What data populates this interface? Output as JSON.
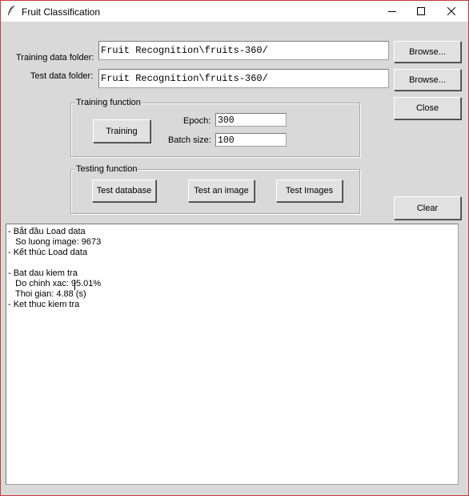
{
  "window": {
    "title": "Fruit Classification",
    "minimize_icon": "minimize-icon",
    "maximize_icon": "maximize-icon",
    "close_icon": "close-icon"
  },
  "form": {
    "training_folder_label": "Training data folder:",
    "training_folder_value": "Fruit Recognition\\fruits-360/",
    "test_folder_label": "Test data folder:",
    "test_folder_value": "Fruit Recognition\\fruits-360/",
    "browse_training_label": "Browse...",
    "browse_test_label": "Browse...",
    "close_label": "Close",
    "clear_label": "Clear"
  },
  "training_group": {
    "title": "Training function",
    "training_button": "Training",
    "epoch_label": "Epoch:",
    "epoch_value": "300",
    "batch_label": "Batch size:",
    "batch_value": "100"
  },
  "testing_group": {
    "title": "Testing function",
    "test_database_button": "Test database",
    "test_image_button": "Test an image",
    "test_images_button": "Test Images"
  },
  "log": {
    "lines": [
      "- Bắt đầu Load data",
      "   So luong image: 9673",
      "- Kết thúc Load data",
      "",
      "- Bat dau kiem tra",
      "   Do chinh xac: 95.01%",
      "   Thoi gian: 4.88 (s)",
      "- Ket thuc kiem tra"
    ]
  }
}
